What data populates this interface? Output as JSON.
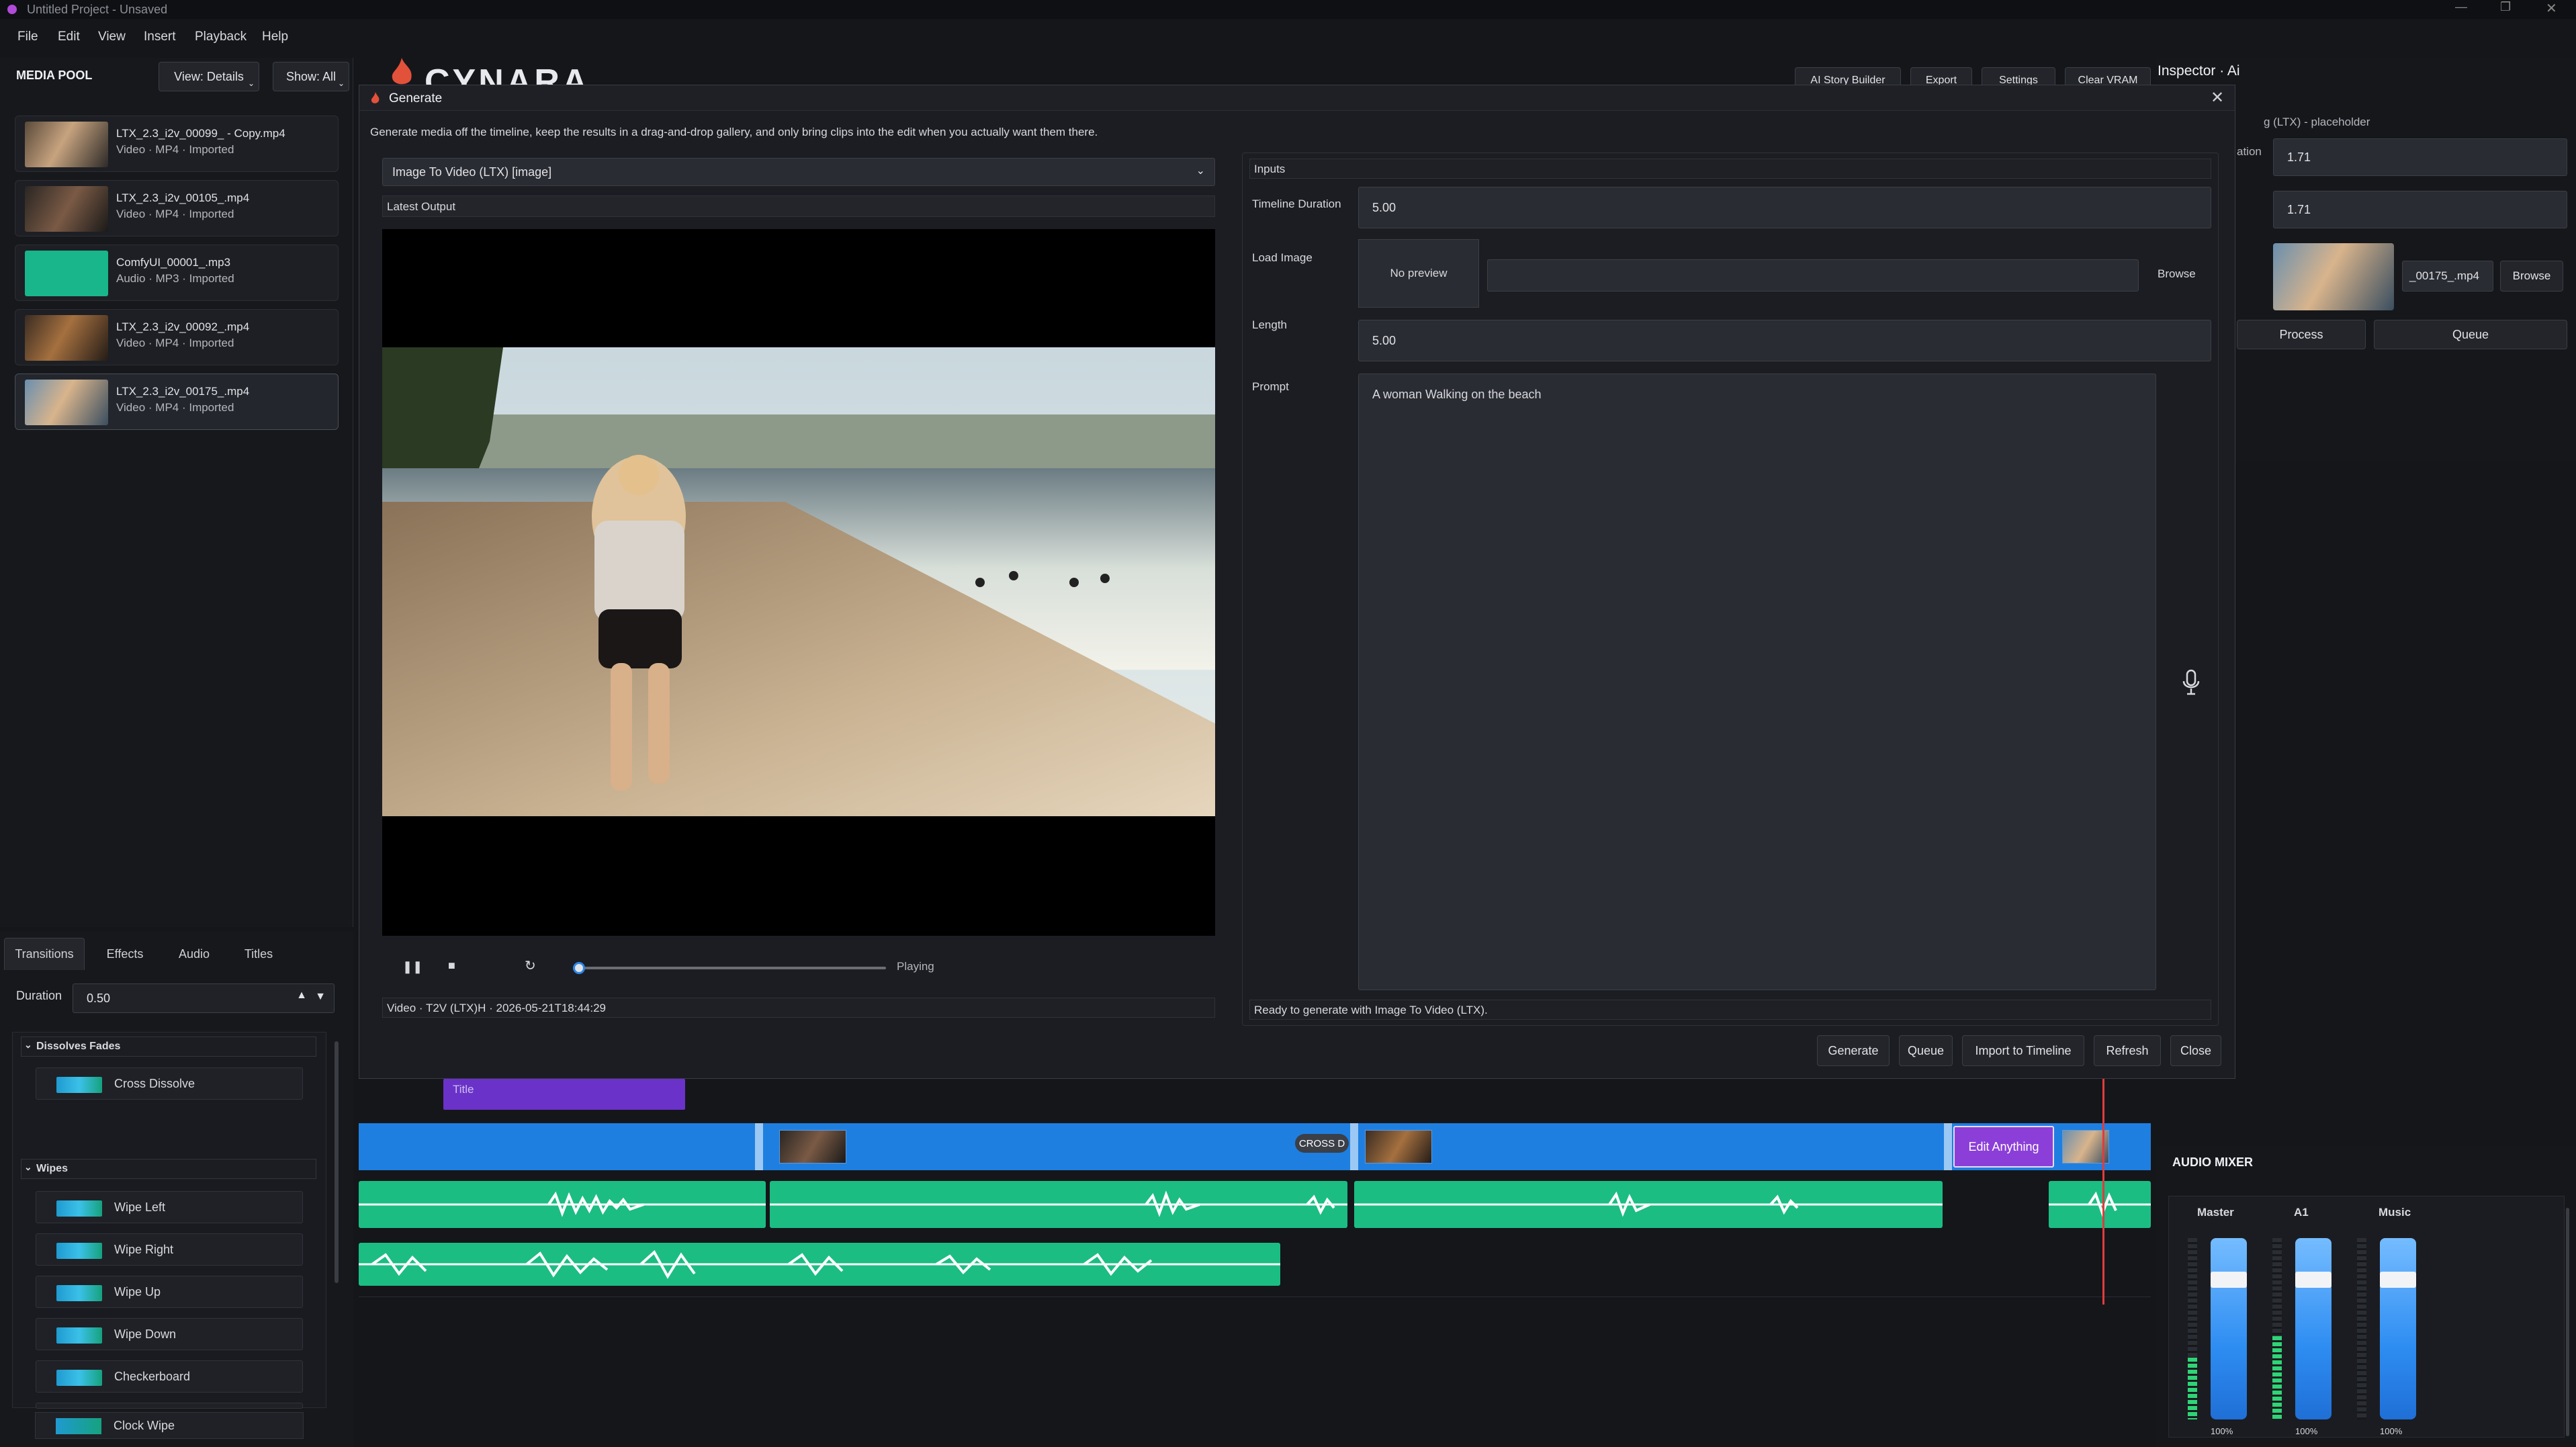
{
  "window": {
    "title": "Untitled Project - Unsaved"
  },
  "menu": [
    "File",
    "Edit",
    "View",
    "Insert",
    "Playback",
    "Help"
  ],
  "header_buttons": [
    "AI Story Builder",
    "Export",
    "Settings",
    "Clear VRAM"
  ],
  "logo_text": "CYNARA",
  "media_pool": {
    "title": "MEDIA POOL",
    "view_label": "View: Details",
    "show_label": "Show: All",
    "items": [
      {
        "name": "LTX_2.3_i2v_00099_ - Copy.mp4",
        "meta": "Video · MP4 · Imported",
        "kind": "video"
      },
      {
        "name": "LTX_2.3_i2v_00105_.mp4",
        "meta": "Video · MP4 · Imported",
        "kind": "video"
      },
      {
        "name": "ComfyUI_00001_.mp3",
        "meta": "Audio · MP3 · Imported",
        "kind": "audio"
      },
      {
        "name": "LTX_2.3_i2v_00092_.mp4",
        "meta": "Video · MP4 · Imported",
        "kind": "video"
      },
      {
        "name": "LTX_2.3_i2v_00175_.mp4",
        "meta": "Video · MP4 · Imported",
        "kind": "video",
        "selected": true
      }
    ]
  },
  "effects_panel": {
    "tabs": [
      "Transitions",
      "Effects",
      "Audio",
      "Titles"
    ],
    "active_tab": "Transitions",
    "duration_label": "Duration",
    "duration_value": "0.50",
    "groups": [
      {
        "name": "Dissolves Fades",
        "items": [
          "Cross Dissolve"
        ]
      },
      {
        "name": "Wipes",
        "items": [
          "Wipe Left",
          "Wipe Right",
          "Wipe Up",
          "Wipe Down",
          "Checkerboard",
          "Clock Wipe"
        ]
      }
    ]
  },
  "dialog": {
    "title": "Generate",
    "description": "Generate media off the timeline, keep the results in a drag-and-drop gallery, and only bring clips into the edit when you actually want them there.",
    "workflow": "Image To Video (LTX) [image]",
    "latest_output_label": "Latest Output",
    "playback_state": "Playing",
    "playback_progress": 0.02,
    "output_info": "Video · T2V (LTX)H · 2026-05-21T18:44:29",
    "inputs_label": "Inputs",
    "timeline_duration_label": "Timeline Duration",
    "timeline_duration_value": "5.00",
    "load_image_label": "Load Image",
    "no_preview": "No preview",
    "image_path": "",
    "browse_label": "Browse",
    "length_label": "Length",
    "length_value": "5.00",
    "prompt_label": "Prompt",
    "prompt_value": "A woman Walking on the beach",
    "status": "Ready to generate with Image To Video (LTX).",
    "buttons": [
      "Generate",
      "Queue",
      "Import to Timeline",
      "Refresh",
      "Close"
    ]
  },
  "inspector": {
    "title": "Inspector · Ai",
    "subtitle": "g (LTX) - placeholder",
    "field_label": "ation",
    "value_1": "1.71",
    "value_2": "1.71",
    "file_label": "_00175_.mp4",
    "browse_label": "Browse",
    "process_label": "Process",
    "queue_label": "Queue"
  },
  "timeline": {
    "title_clip": "Title",
    "transition_label": "CROSS D",
    "edit_label": "Edit Anything"
  },
  "audio_mixer": {
    "title": "AUDIO MIXER",
    "channels": [
      {
        "name": "Master",
        "level": "100%",
        "value": 1.0
      },
      {
        "name": "A1",
        "level": "100%",
        "value": 1.0
      },
      {
        "name": "Music",
        "level": "100%",
        "value": 1.0
      }
    ]
  },
  "colors": {
    "accent": "#1e7fe0",
    "audio": "#1bbd83",
    "title_clip": "#6a32c9",
    "playhead": "#e23b3b"
  }
}
